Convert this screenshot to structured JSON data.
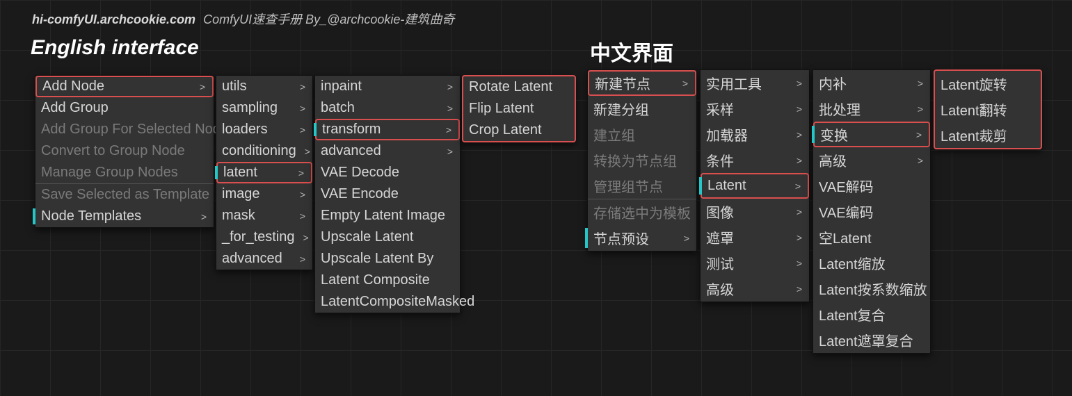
{
  "watermark": {
    "site": "hi-comfyUI.archcookie.com",
    "desc": "ComfyUI速查手册 By_@archcookie-建筑曲奇"
  },
  "headings": {
    "en": "English interface",
    "zh": "中文界面"
  },
  "en": {
    "ctx": [
      {
        "label": "Add Node",
        "arrow": true,
        "hl": true
      },
      {
        "label": "Add Group"
      },
      {
        "label": "Add Group For Selected Nodes",
        "disabled": true
      },
      {
        "label": "Convert to Group Node",
        "disabled": true
      },
      {
        "label": "Manage Group Nodes",
        "disabled": true
      },
      {
        "sep": true
      },
      {
        "label": "Save Selected as Template",
        "disabled": true
      },
      {
        "label": "Node Templates",
        "arrow": true,
        "tick": true
      }
    ],
    "cat": [
      {
        "label": "utils",
        "arrow": true
      },
      {
        "label": "sampling",
        "arrow": true
      },
      {
        "label": "loaders",
        "arrow": true
      },
      {
        "label": "conditioning",
        "arrow": true
      },
      {
        "label": "latent",
        "arrow": true,
        "hl": true,
        "tick": true
      },
      {
        "label": "image",
        "arrow": true
      },
      {
        "label": "mask",
        "arrow": true
      },
      {
        "label": "_for_testing",
        "arrow": true
      },
      {
        "label": "advanced",
        "arrow": true
      }
    ],
    "latent": [
      {
        "label": "inpaint",
        "arrow": true
      },
      {
        "label": "batch",
        "arrow": true
      },
      {
        "label": "transform",
        "arrow": true,
        "hl": true,
        "tick": true
      },
      {
        "label": "advanced",
        "arrow": true
      },
      {
        "label": "VAE Decode"
      },
      {
        "label": "VAE Encode"
      },
      {
        "label": "Empty Latent Image"
      },
      {
        "label": "Upscale Latent"
      },
      {
        "label": "Upscale Latent By"
      },
      {
        "label": "Latent Composite"
      },
      {
        "label": "LatentCompositeMasked"
      }
    ],
    "transform": [
      {
        "label": "Rotate Latent"
      },
      {
        "label": "Flip Latent"
      },
      {
        "label": "Crop Latent"
      }
    ]
  },
  "zh": {
    "ctx": [
      {
        "label": "新建节点",
        "arrow": true,
        "hl": true
      },
      {
        "label": "新建分组"
      },
      {
        "label": "建立组",
        "disabled": true
      },
      {
        "label": "转换为节点组",
        "disabled": true
      },
      {
        "label": "管理组节点",
        "disabled": true
      },
      {
        "sep": true
      },
      {
        "label": "存储选中为模板",
        "disabled": true
      },
      {
        "label": "节点预设",
        "arrow": true,
        "tick": true
      }
    ],
    "cat": [
      {
        "label": "实用工具",
        "arrow": true
      },
      {
        "label": "采样",
        "arrow": true
      },
      {
        "label": "加载器",
        "arrow": true
      },
      {
        "label": "条件",
        "arrow": true
      },
      {
        "label": "Latent",
        "arrow": true,
        "hl": true,
        "tick": true
      },
      {
        "label": "图像",
        "arrow": true
      },
      {
        "label": "遮罩",
        "arrow": true
      },
      {
        "label": "测试",
        "arrow": true
      },
      {
        "label": "高级",
        "arrow": true
      }
    ],
    "latent": [
      {
        "label": "内补",
        "arrow": true
      },
      {
        "label": "批处理",
        "arrow": true
      },
      {
        "label": "变换",
        "arrow": true,
        "hl": true,
        "tick": true
      },
      {
        "label": "高级",
        "arrow": true
      },
      {
        "label": "VAE解码"
      },
      {
        "label": "VAE编码"
      },
      {
        "label": "空Latent"
      },
      {
        "label": "Latent缩放"
      },
      {
        "label": "Latent按系数缩放"
      },
      {
        "label": "Latent复合"
      },
      {
        "label": "Latent遮罩复合"
      }
    ],
    "transform": [
      {
        "label": "Latent旋转"
      },
      {
        "label": "Latent翻转"
      },
      {
        "label": "Latent裁剪"
      }
    ]
  },
  "arrowGlyph": ">"
}
